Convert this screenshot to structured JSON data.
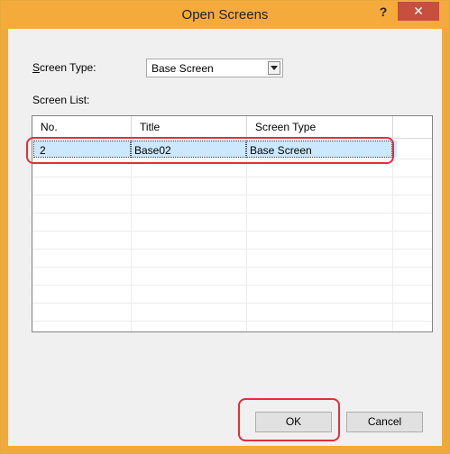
{
  "dialog": {
    "title": "Open Screens",
    "help_label": "?",
    "close_label": "✕"
  },
  "screen_type": {
    "label_access": "S",
    "label_rest": "creen Type:",
    "selected": "Base Screen"
  },
  "screen_list": {
    "label": "Screen List:",
    "columns": [
      "No.",
      "Title",
      "Screen Type"
    ],
    "rows": [
      {
        "no": "2",
        "title": "Base02",
        "type": "Base Screen"
      }
    ]
  },
  "buttons": {
    "ok": "OK",
    "cancel": "Cancel"
  },
  "colors": {
    "titlebar": "#f4ab3c",
    "close": "#c74f3d",
    "selection": "#cce8ff",
    "annotation": "#e0303c"
  }
}
